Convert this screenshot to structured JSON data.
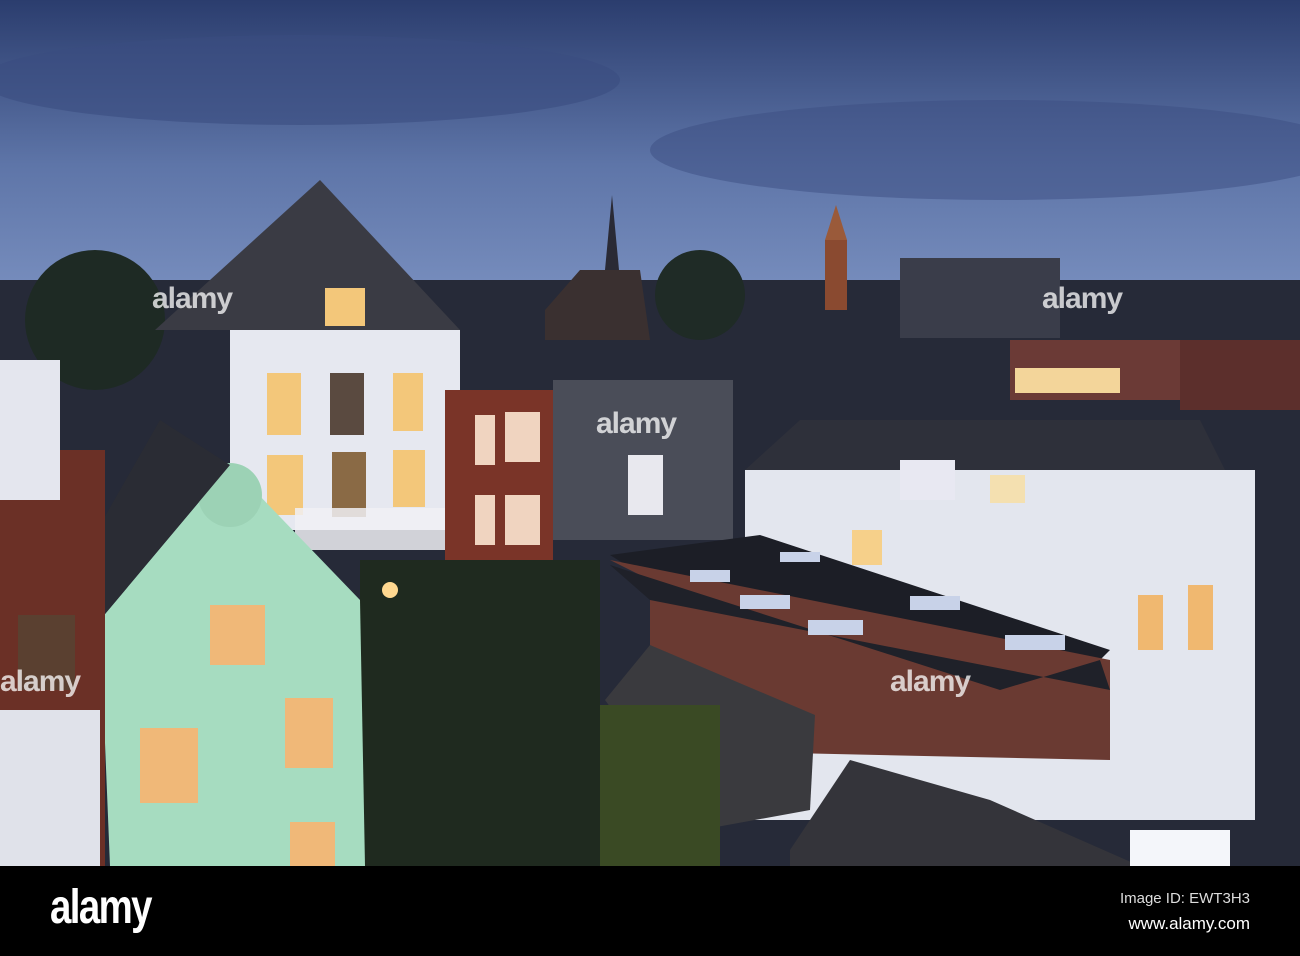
{
  "watermark": {
    "brand": "alamy",
    "image_id": "Image ID: EWT3H3",
    "site": "www.alamy.com"
  },
  "colors": {
    "sky_top": "#2b3d6e",
    "sky_bottom": "#6f86b8",
    "window_light": "#f3c77a",
    "green_house": "#9fd6b8",
    "brick": "#7a3428"
  }
}
